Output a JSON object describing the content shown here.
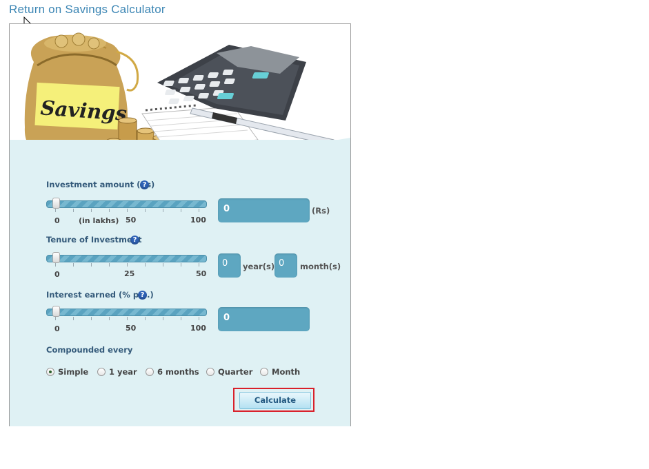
{
  "page": {
    "title": "Return on Savings Calculator"
  },
  "hero": {
    "bag_text": "Savings"
  },
  "investment": {
    "label": "Investment amount (Rs)",
    "help": "?",
    "slider_value": 0,
    "tick_min": "0",
    "tick_unit": "(in lakhs)",
    "tick_mid": "50",
    "tick_max": "100",
    "value": "0",
    "unit": "(Rs)"
  },
  "tenure": {
    "label": "Tenure of Investment",
    "help": "?",
    "slider_value": 0,
    "tick_min": "0",
    "tick_mid": "25",
    "tick_max": "50",
    "years_value": "0",
    "years_label": "year(s)",
    "months_value": "0",
    "months_label": "month(s)"
  },
  "interest": {
    "label": "Interest earned (% p.a.)",
    "help": "?",
    "slider_value": 0,
    "tick_min": "0",
    "tick_mid": "50",
    "tick_max": "100",
    "value": "0"
  },
  "compounding": {
    "label": "Compounded every",
    "selected": "Simple",
    "options": [
      "Simple",
      "1 year",
      "6 months",
      "Quarter",
      "Month"
    ]
  },
  "actions": {
    "calculate_label": "Calculate"
  },
  "colors": {
    "title": "#3c86b4",
    "form_background": "#dff1f4",
    "value_box": "#5ea7c1",
    "highlight_outline": "#d9202a"
  }
}
